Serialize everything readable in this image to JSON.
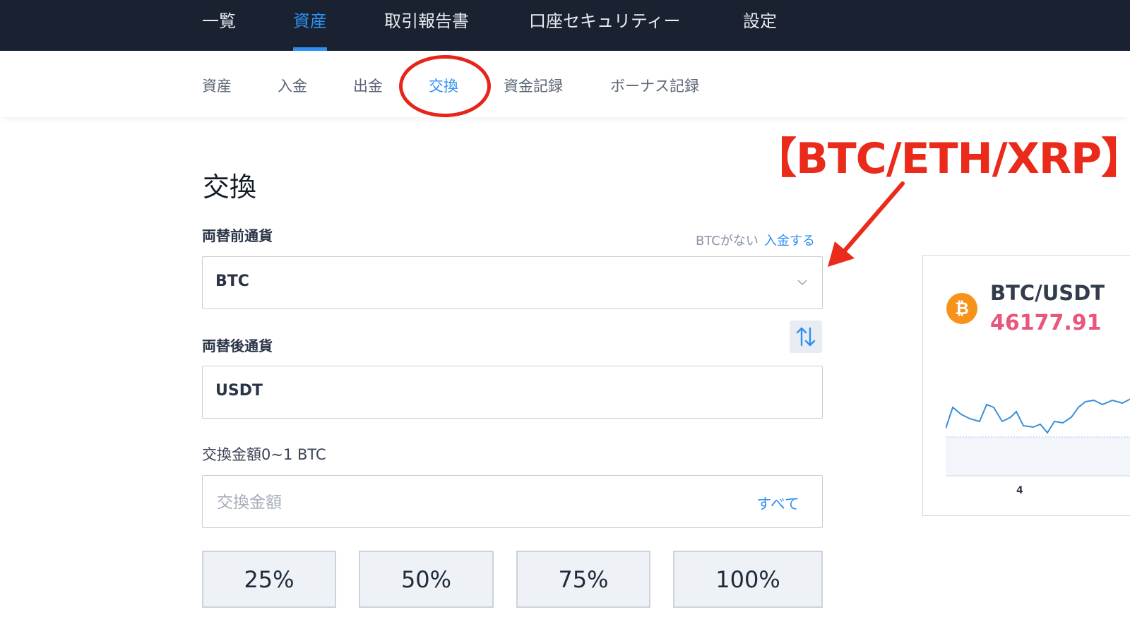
{
  "top_nav": {
    "tabs": [
      {
        "label": "一覧"
      },
      {
        "label": "資産"
      },
      {
        "label": "取引報告書"
      },
      {
        "label": "口座セキュリティー"
      },
      {
        "label": "設定"
      }
    ],
    "active": "資産"
  },
  "sub_nav": {
    "tabs": [
      {
        "label": "資産"
      },
      {
        "label": "入金"
      },
      {
        "label": "出金"
      },
      {
        "label": "交換"
      },
      {
        "label": "資金記録"
      },
      {
        "label": "ボーナス記録"
      }
    ],
    "active": "交換"
  },
  "annotation": {
    "text": "【BTC/ETH/XRP】",
    "color": "#ea2a1b"
  },
  "exchange": {
    "title": "交換",
    "from_label": "両替前通貨",
    "from_hint": "BTCがない",
    "from_hint_link": "入金する",
    "from_value": "BTC",
    "to_label": "両替後通貨",
    "to_value": "USDT",
    "amount_label": "交換金額0~1 BTC",
    "amount_placeholder": "交換金額",
    "all_label": "すべて",
    "percent_buttons": [
      "25%",
      "50%",
      "75%",
      "100%"
    ]
  },
  "ticker": {
    "pair": "BTC/USDT",
    "price": "46177.91",
    "coin_symbol": "₿",
    "x_tick": "4"
  },
  "colors": {
    "accent": "#2e8ff0",
    "nav_bg": "#1a2231",
    "price": "#e8567b",
    "btc_orange": "#f7931a"
  }
}
